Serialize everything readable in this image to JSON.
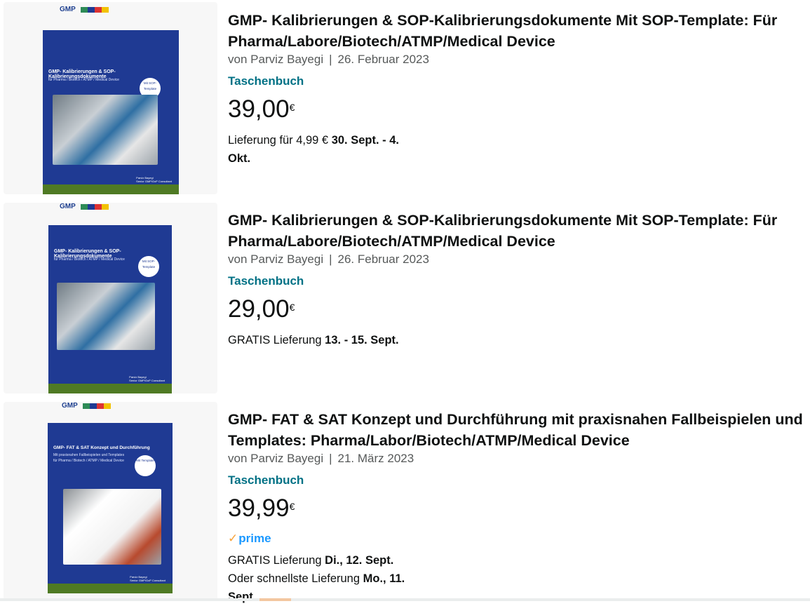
{
  "results": [
    {
      "title": "GMP- Kalibrierungen & SOP-Kalibrierungsdokumente Mit SOP-Template: Für Pharma/Labore/Biotech/ATMP/Medical Device",
      "byline_prefix": "von",
      "author": "Parviz Bayegi",
      "separator": "|",
      "date": "26. Februar 2023",
      "format": "Taschenbuch",
      "price_whole": "39,00",
      "price_currency": "€",
      "delivery_lines": [
        {
          "prefix": "Lieferung für 4,99 € ",
          "bold": "30. Sept. - 4."
        },
        {
          "prefix": "",
          "bold": "Okt."
        }
      ],
      "cover": {
        "brand": "GMP",
        "title": "GMP- Kalibrierungen & SOP-Kalibrierungsdokumente",
        "subtitle": "für Pharma / Biotech / ATMP / Medical Device",
        "badge": "Mit SOP-Template",
        "author_lines": [
          "Parviz Bayegi",
          "Senior GMP/GxP Consultant"
        ]
      }
    },
    {
      "title": "GMP- Kalibrierungen & SOP-Kalibrierungsdokumente Mit SOP-Template: Für Pharma/Labore/Biotech/ATMP/Medical Device",
      "byline_prefix": "von",
      "author": "Parviz Bayegi",
      "separator": "|",
      "date": "26. Februar 2023",
      "format": "Taschenbuch",
      "price_whole": "29,00",
      "price_currency": "€",
      "delivery_lines": [
        {
          "prefix": "GRATIS Lieferung ",
          "bold": "13. - 15. Sept."
        }
      ],
      "cover": {
        "brand": "GMP",
        "title": "GMP- Kalibrierungen & SOP-Kalibrierungsdokumente",
        "subtitle": "für Pharma / Biotech / ATMP / Medical Device",
        "badge": "Mit SOP-Template",
        "author_lines": [
          "Parviz Bayegi",
          "Senior GMP/GxP Consultant"
        ]
      }
    },
    {
      "title": "GMP- FAT & SAT Konzept und Durchführung mit praxisnahen Fallbeispielen und Templates: Pharma/Labor/Biotech/ATMP/Medical Device",
      "byline_prefix": "von",
      "author": "Parviz Bayegi",
      "separator": "|",
      "date": "21. März 2023",
      "format": "Taschenbuch",
      "price_whole": "39,99",
      "price_currency": "€",
      "prime_label": "prime",
      "delivery_lines": [
        {
          "prefix": "GRATIS Lieferung ",
          "bold": "Di., 12. Sept."
        },
        {
          "prefix": "Oder schnellste Lieferung ",
          "bold": "Mo., 11."
        },
        {
          "prefix": "",
          "bold": "Sept."
        }
      ],
      "cover": {
        "brand": "GMP",
        "title": "GMP- FAT & SAT Konzept und Durchführung",
        "subtitle": "Mit praxisnahen Fallbeispielen und Templates",
        "subtitle2": "für Pharma / Biotech / ATMP / Medical Device",
        "badge": "Mit Template",
        "author_lines": [
          "Parviz Bayegi",
          "Senior GMP/GxP Consultant"
        ]
      }
    }
  ],
  "colors": {
    "link_teal": "#007185",
    "cover_blue": "#1f3a93",
    "cover_green": "#4f7a24",
    "prime_blue": "#1a98ff",
    "prime_check": "#f7a23a"
  }
}
